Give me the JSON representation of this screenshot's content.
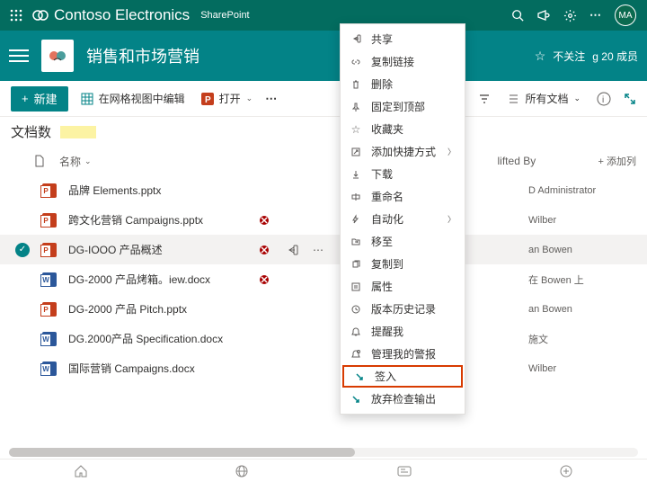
{
  "suite": {
    "org": "Contoso Electronics",
    "app": "SharePoint",
    "avatar": "MA"
  },
  "site": {
    "title": "销售和市场营销",
    "follow": "不关注",
    "members": "g 20 成员"
  },
  "cmd": {
    "new": "新建",
    "grid": "在网格视图中编辑",
    "open": "打开",
    "view": "所有文档"
  },
  "sub": {
    "count": "文档数"
  },
  "cols": {
    "name": "名称",
    "lifted": "lifted By",
    "add": "添加列"
  },
  "rows": [
    {
      "t": "pp",
      "n": "品牌 Elements.pptx",
      "st": "",
      "by": "D Administrator"
    },
    {
      "t": "pp",
      "n": "跨文化营销 Campaigns.pptx",
      "st": "●",
      "by": "Wilber"
    },
    {
      "t": "pp",
      "n": "DG-IOOO 产品概述",
      "st": "●",
      "by": "an Bowen",
      "sel": true
    },
    {
      "t": "w",
      "n": "DG-2000 产品烤箱。iew.docx",
      "st": "●",
      "by": "在 Bowen 上"
    },
    {
      "t": "pp",
      "n": "DG-2000 产品 Pitch.pptx",
      "st": "",
      "by": "an Bowen"
    },
    {
      "t": "w",
      "n": "DG.2000产品 Specification.docx",
      "st": "",
      "by": "施文"
    },
    {
      "t": "w",
      "n": "国际营销 Campaigns.docx",
      "st": "",
      "by": "Wilber"
    }
  ],
  "menu": [
    {
      "i": "share",
      "l": "共享"
    },
    {
      "i": "link",
      "l": "复制链接"
    },
    {
      "i": "del",
      "l": "删除"
    },
    {
      "i": "pin",
      "l": "固定到顶部"
    },
    {
      "i": "star",
      "l": "收藏夹"
    },
    {
      "i": "short",
      "l": "添加快捷方式",
      "sub": true
    },
    {
      "i": "down",
      "l": "下载"
    },
    {
      "i": "ren",
      "l": "重命名"
    },
    {
      "i": "auto",
      "l": "自动化",
      "sub": true
    },
    {
      "i": "move",
      "l": "移至"
    },
    {
      "i": "copy",
      "l": "复制到"
    },
    {
      "i": "prop",
      "l": "属性"
    },
    {
      "i": "hist",
      "l": "版本历史记录"
    },
    {
      "i": "alert",
      "l": "提醒我"
    },
    {
      "i": "mgr",
      "l": "管理我的警报"
    },
    {
      "i": "in",
      "l": "签入",
      "hl": true
    },
    {
      "i": "discard",
      "l": "放弃检查输出"
    }
  ]
}
